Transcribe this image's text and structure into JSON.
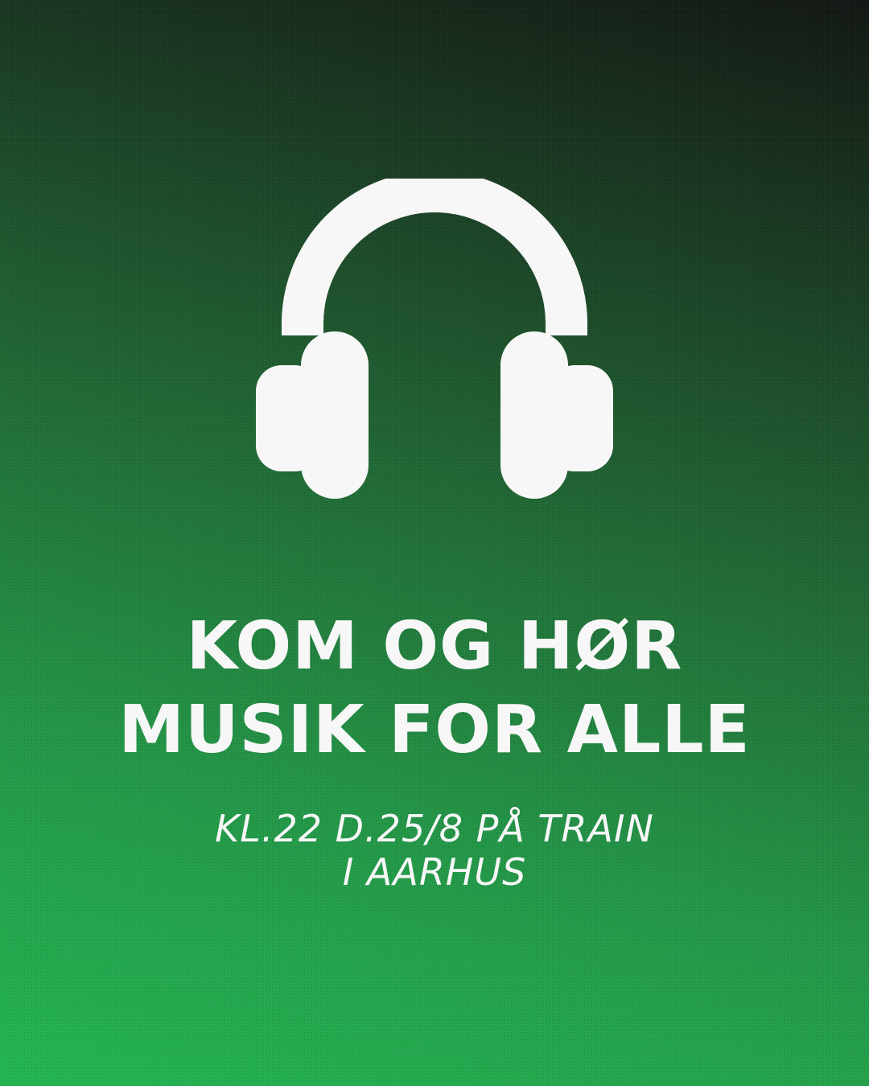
{
  "poster": {
    "background_colors": [
      "#0e130f",
      "#1d6a33",
      "#1fb44f"
    ],
    "text_color": "#f7f7f7",
    "icon": "headphones-icon",
    "headline": [
      "KOM OG HØR",
      "MUSIK FOR ALLE"
    ],
    "details": [
      "KL.22 D.25/8 PÅ TRAIN",
      "I AARHUS"
    ]
  }
}
